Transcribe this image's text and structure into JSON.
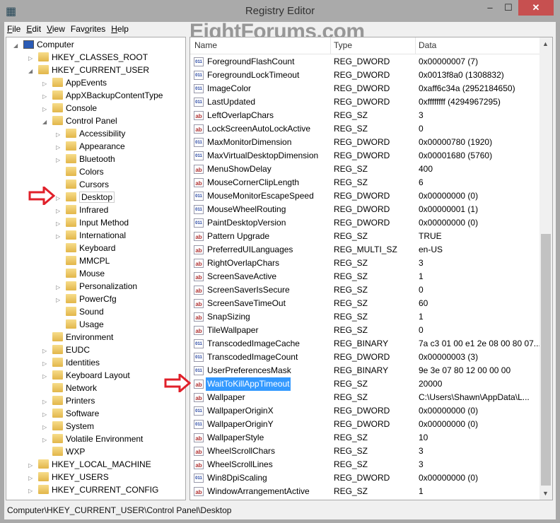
{
  "window": {
    "title": "Registry Editor",
    "close": "✕",
    "minimize": "–",
    "maximize": "☐"
  },
  "menu": [
    {
      "key": "F",
      "rest": "ile"
    },
    {
      "key": "E",
      "rest": "dit"
    },
    {
      "key": "V",
      "rest": "iew"
    },
    {
      "pre": "Fav",
      "key": "o",
      "rest": "rites"
    },
    {
      "key": "H",
      "rest": "elp"
    }
  ],
  "watermark": "EightForums.com",
  "tree": [
    {
      "label": "Computer",
      "level": 0,
      "exp": "◢",
      "icon": "computer"
    },
    {
      "label": "HKEY_CLASSES_ROOT",
      "level": 1,
      "exp": "▷"
    },
    {
      "label": "HKEY_CURRENT_USER",
      "level": 1,
      "exp": "◢"
    },
    {
      "label": "AppEvents",
      "level": 2,
      "exp": "▷"
    },
    {
      "label": "AppXBackupContentType",
      "level": 2,
      "exp": "▷"
    },
    {
      "label": "Console",
      "level": 2,
      "exp": "▷"
    },
    {
      "label": "Control Panel",
      "level": 2,
      "exp": "◢"
    },
    {
      "label": "Accessibility",
      "level": 3,
      "exp": "▷"
    },
    {
      "label": "Appearance",
      "level": 3,
      "exp": "▷"
    },
    {
      "label": "Bluetooth",
      "level": 3,
      "exp": "▷"
    },
    {
      "label": "Colors",
      "level": 3,
      "exp": ""
    },
    {
      "label": "Cursors",
      "level": 3,
      "exp": ""
    },
    {
      "label": "Desktop",
      "level": 3,
      "exp": "▷",
      "selected": true
    },
    {
      "label": "Infrared",
      "level": 3,
      "exp": "▷"
    },
    {
      "label": "Input Method",
      "level": 3,
      "exp": "▷"
    },
    {
      "label": "International",
      "level": 3,
      "exp": "▷"
    },
    {
      "label": "Keyboard",
      "level": 3,
      "exp": ""
    },
    {
      "label": "MMCPL",
      "level": 3,
      "exp": ""
    },
    {
      "label": "Mouse",
      "level": 3,
      "exp": ""
    },
    {
      "label": "Personalization",
      "level": 3,
      "exp": "▷"
    },
    {
      "label": "PowerCfg",
      "level": 3,
      "exp": "▷"
    },
    {
      "label": "Sound",
      "level": 3,
      "exp": ""
    },
    {
      "label": "Usage",
      "level": 3,
      "exp": ""
    },
    {
      "label": "Environment",
      "level": 2,
      "exp": ""
    },
    {
      "label": "EUDC",
      "level": 2,
      "exp": "▷"
    },
    {
      "label": "Identities",
      "level": 2,
      "exp": "▷"
    },
    {
      "label": "Keyboard Layout",
      "level": 2,
      "exp": "▷"
    },
    {
      "label": "Network",
      "level": 2,
      "exp": ""
    },
    {
      "label": "Printers",
      "level": 2,
      "exp": "▷"
    },
    {
      "label": "Software",
      "level": 2,
      "exp": "▷"
    },
    {
      "label": "System",
      "level": 2,
      "exp": "▷"
    },
    {
      "label": "Volatile Environment",
      "level": 2,
      "exp": "▷"
    },
    {
      "label": "WXP",
      "level": 2,
      "exp": ""
    },
    {
      "label": "HKEY_LOCAL_MACHINE",
      "level": 1,
      "exp": "▷"
    },
    {
      "label": "HKEY_USERS",
      "level": 1,
      "exp": "▷"
    },
    {
      "label": "HKEY_CURRENT_CONFIG",
      "level": 1,
      "exp": "▷"
    }
  ],
  "columns": {
    "name": "Name",
    "type": "Type",
    "data": "Data"
  },
  "values": [
    [
      "ForegroundFlashCount",
      "REG_DWORD",
      "0x00000007 (7)"
    ],
    [
      "ForegroundLockTimeout",
      "REG_DWORD",
      "0x0013f8a0 (1308832)"
    ],
    [
      "ImageColor",
      "REG_DWORD",
      "0xaff6c34a (2952184650)"
    ],
    [
      "LastUpdated",
      "REG_DWORD",
      "0xffffffff (4294967295)"
    ],
    [
      "LeftOverlapChars",
      "REG_SZ",
      "3"
    ],
    [
      "LockScreenAutoLockActive",
      "REG_SZ",
      "0"
    ],
    [
      "MaxMonitorDimension",
      "REG_DWORD",
      "0x00000780 (1920)"
    ],
    [
      "MaxVirtualDesktopDimension",
      "REG_DWORD",
      "0x00001680 (5760)"
    ],
    [
      "MenuShowDelay",
      "REG_SZ",
      "400"
    ],
    [
      "MouseCornerClipLength",
      "REG_SZ",
      "6"
    ],
    [
      "MouseMonitorEscapeSpeed",
      "REG_DWORD",
      "0x00000000 (0)"
    ],
    [
      "MouseWheelRouting",
      "REG_DWORD",
      "0x00000001 (1)"
    ],
    [
      "PaintDesktopVersion",
      "REG_DWORD",
      "0x00000000 (0)"
    ],
    [
      "Pattern Upgrade",
      "REG_SZ",
      "TRUE"
    ],
    [
      "PreferredUILanguages",
      "REG_MULTI_SZ",
      "en-US"
    ],
    [
      "RightOverlapChars",
      "REG_SZ",
      "3"
    ],
    [
      "ScreenSaveActive",
      "REG_SZ",
      "1"
    ],
    [
      "ScreenSaverIsSecure",
      "REG_SZ",
      "0"
    ],
    [
      "ScreenSaveTimeOut",
      "REG_SZ",
      "60"
    ],
    [
      "SnapSizing",
      "REG_SZ",
      "1"
    ],
    [
      "TileWallpaper",
      "REG_SZ",
      "0"
    ],
    [
      "TranscodedImageCache",
      "REG_BINARY",
      "7a c3 01 00 e1 2e 08 00 80 07..."
    ],
    [
      "TranscodedImageCount",
      "REG_DWORD",
      "0x00000003 (3)"
    ],
    [
      "UserPreferencesMask",
      "REG_BINARY",
      "9e 3e 07 80 12 00 00 00"
    ],
    [
      "WaitToKillAppTimeout",
      "REG_SZ",
      "20000"
    ],
    [
      "Wallpaper",
      "REG_SZ",
      "C:\\Users\\Shawn\\AppData\\L..."
    ],
    [
      "WallpaperOriginX",
      "REG_DWORD",
      "0x00000000 (0)"
    ],
    [
      "WallpaperOriginY",
      "REG_DWORD",
      "0x00000000 (0)"
    ],
    [
      "WallpaperStyle",
      "REG_SZ",
      "10"
    ],
    [
      "WheelScrollChars",
      "REG_SZ",
      "3"
    ],
    [
      "WheelScrollLines",
      "REG_SZ",
      "3"
    ],
    [
      "Win8DpiScaling",
      "REG_DWORD",
      "0x00000000 (0)"
    ],
    [
      "WindowArrangementActive",
      "REG_SZ",
      "1"
    ]
  ],
  "selected_value": "WaitToKillAppTimeout",
  "scroll": {
    "position_fraction": 1.0,
    "visible_fraction": 0.58
  },
  "status": "Computer\\HKEY_CURRENT_USER\\Control Panel\\Desktop",
  "colors": {
    "highlight": "#3399ff",
    "arrow": "#e0202a",
    "close": "#c75050"
  }
}
